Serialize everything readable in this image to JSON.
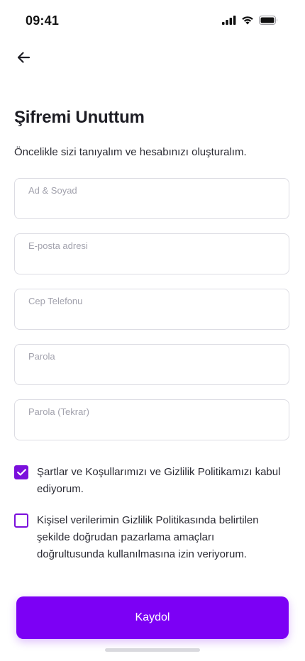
{
  "status_bar": {
    "time": "09:41",
    "icons": [
      "signal-icon",
      "wifi-icon",
      "battery-icon"
    ]
  },
  "header": {
    "back_icon": "arrow-left-icon"
  },
  "main": {
    "title": "Şifremi Unuttum",
    "subtitle": "Öncelikle sizi tanıyalım ve hesabınızı oluşturalım.",
    "fields": [
      {
        "label": "Ad & Soyad",
        "value": ""
      },
      {
        "label": "E-posta adresi",
        "value": ""
      },
      {
        "label": "Cep Telefonu",
        "value": ""
      },
      {
        "label": "Parola",
        "value": ""
      },
      {
        "label": "Parola (Tekrar)",
        "value": ""
      }
    ],
    "checkboxes": [
      {
        "label": "Şartlar ve Koşullarımızı ve Gizlilik Politikamızı kabul ediyorum.",
        "checked": true
      },
      {
        "label": "Kişisel verilerimin Gizlilik Politikasında belirtilen şekilde doğrudan pazarlama amaçları doğrultusunda kullanılmasına izin veriyorum.",
        "checked": false
      }
    ],
    "submit_label": "Kaydol"
  },
  "colors": {
    "accent": "#7c00f5",
    "checkbox": "#7b0fdc",
    "field_border": "#dcdce3",
    "label_gray": "#a2a2ad"
  }
}
